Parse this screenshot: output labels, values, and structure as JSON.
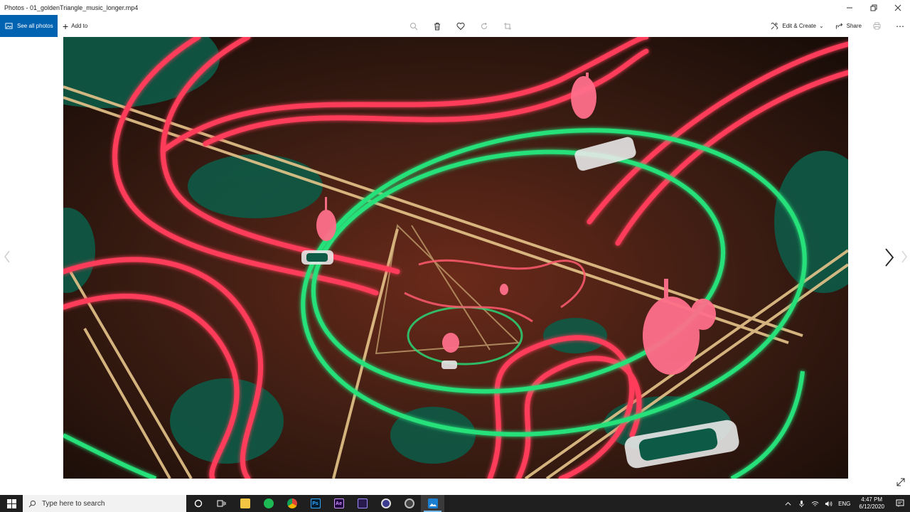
{
  "window": {
    "title": "Photos - 01_goldenTriangle_music_longer.mp4"
  },
  "toolbar": {
    "see_all_photos": "See all photos",
    "add_to": "Add to",
    "edit_create": "Edit & Create",
    "share": "Share",
    "center_icons": [
      "zoom-icon",
      "delete-icon",
      "favorite-icon",
      "rotate-icon",
      "crop-icon"
    ]
  },
  "taskbar": {
    "search_placeholder": "Type here to search",
    "apps": [
      "task-view",
      "file-explorer",
      "spotify",
      "chrome",
      "photoshop",
      "after-effects",
      "premiere-like",
      "obs-like",
      "screen-recorder",
      "photos"
    ],
    "language": "ENG",
    "time": "4:47 PM",
    "date": "6/12/2020"
  },
  "colors": {
    "accent": "#0063b1",
    "taskbar": "#1f1f1f",
    "neon_red": "#ff3c5a",
    "neon_green": "#27e07a",
    "frame_bg": "#2a1710"
  }
}
